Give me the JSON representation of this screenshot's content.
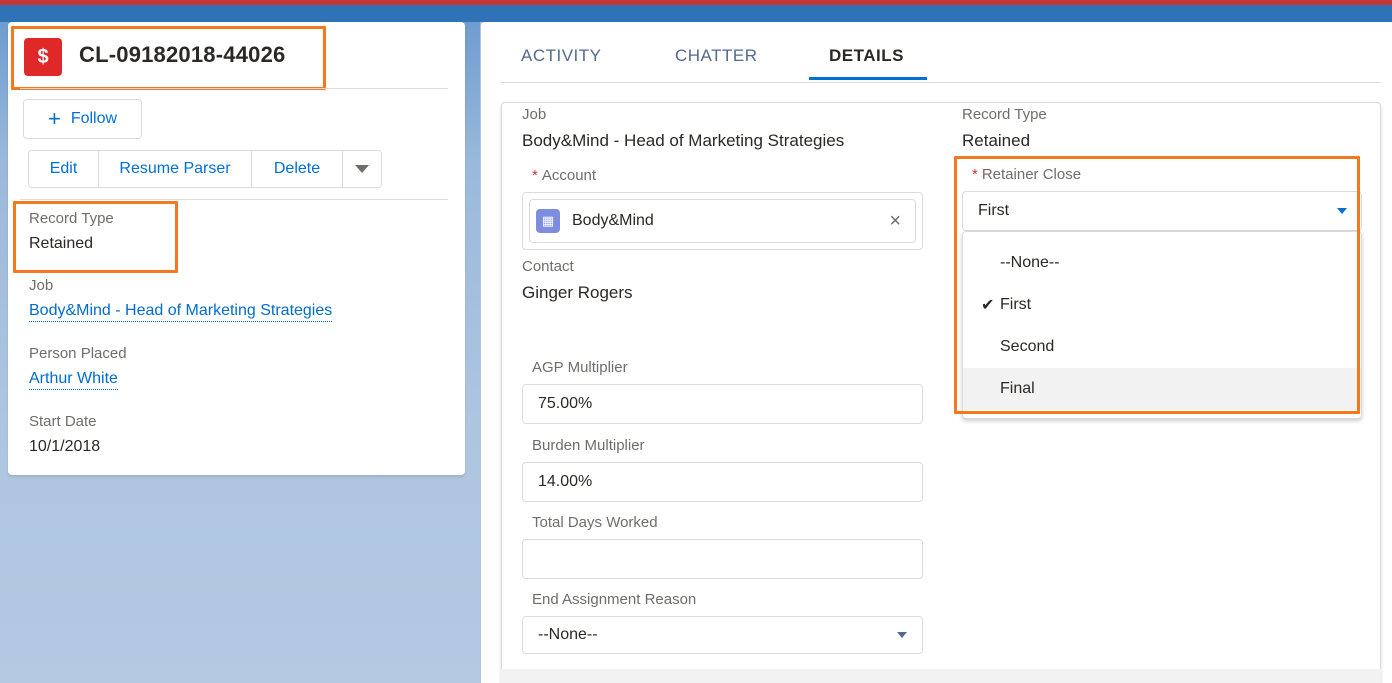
{
  "record": {
    "icon_glyph": "$",
    "title": "CL-09182018-44026",
    "follow_label": "Follow",
    "follow_icon": "+",
    "actions": [
      "Edit",
      "Resume Parser",
      "Delete"
    ]
  },
  "highlights": [
    {
      "label": "Record Type",
      "value": "Retained"
    },
    {
      "label": "Job",
      "value": "Body&Mind - Head of Marketing Strategies"
    },
    {
      "label": "Person Placed",
      "value": "Arthur White"
    },
    {
      "label": "Start Date",
      "value": "10/1/2018"
    }
  ],
  "tabs": [
    {
      "label": "ACTIVITY",
      "active": false
    },
    {
      "label": "CHATTER",
      "active": false
    },
    {
      "label": "DETAILS",
      "active": true
    }
  ],
  "details": {
    "job_label": "Job",
    "job_value": "Body&Mind - Head of Marketing Strategies",
    "record_type_label": "Record Type",
    "record_type_value": "Retained",
    "account_required": "*",
    "account_label": "Account",
    "account_value": "Body&Mind",
    "account_clear_icon": "×",
    "retainer_required": "*",
    "retainer_label": "Retainer Close",
    "retainer_value": "First",
    "retainer_options": [
      "--None--",
      "First",
      "Second",
      "Final"
    ],
    "retainer_selected_mark": "✔",
    "contact_label": "Contact",
    "contact_value": "Ginger Rogers",
    "agp_label": "AGP Multiplier",
    "agp_value": "75.00%",
    "burden_label": "Burden Multiplier",
    "burden_value": "14.00%",
    "days_label": "Total Days Worked",
    "days_value": "",
    "end_reason_label": "End Assignment Reason",
    "end_reason_value": "--None--"
  },
  "colors": {
    "brand_blue": "#0070d2",
    "record_red": "#e02828",
    "highlight_orange": "#f5781f",
    "account_icon": "#7f8de1"
  }
}
